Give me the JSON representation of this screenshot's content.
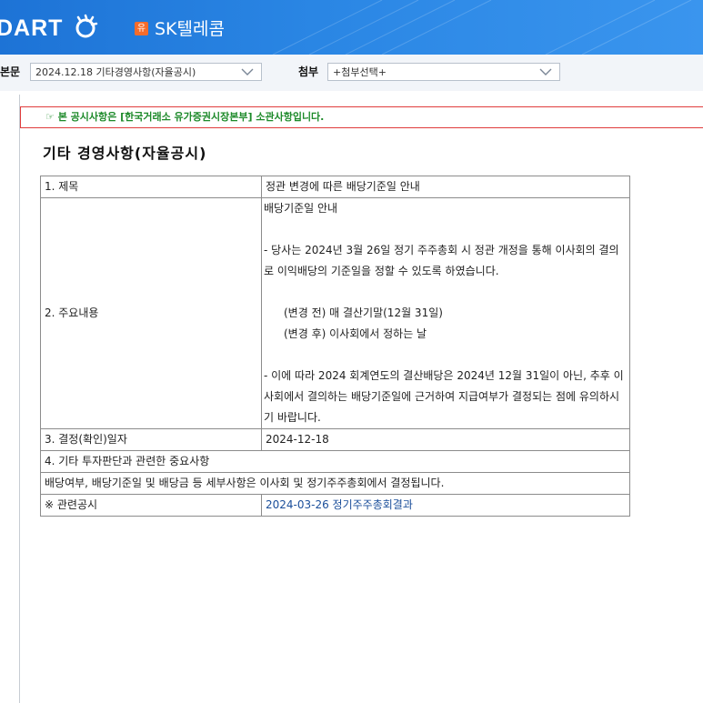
{
  "header": {
    "logo_text": "DART",
    "corp_badge": "유",
    "corp_name": "SK텔레콤"
  },
  "toolbar": {
    "body_label": "본문",
    "body_select": "2024.12.18  기타경영사항(자율공시)",
    "attach_label": "첨부",
    "attach_select": "+첨부선택+"
  },
  "notice": "☞ 본 공시사항은 [한국거래소 유가증권시장본부] 소관사항입니다.",
  "doc_title": "기타 경영사항(자율공시)",
  "rows": {
    "title": {
      "label": "1. 제목",
      "value": "정관 변경에 따른 배당기준일 안내"
    },
    "main": {
      "label": "2. 주요내용",
      "heading": "배당기준일 안내",
      "para1": "- 당사는 2024년 3월 26일 정기 주주총회 시 정관 개정을 통해 이사회의 결의로 이익배당의 기준일을 정할 수 있도록 하였습니다.",
      "before": "(변경 전) 매 결산기말(12월 31일)",
      "after": "(변경 후) 이사회에서 정하는 날",
      "para2": "- 이에 따라 2024 회계연도의 결산배당은 2024년 12월 31일이 아닌, 추후 이사회에서 결의하는 배당기준일에 근거하여 지급여부가 결정되는 점에 유의하시기 바랍니다."
    },
    "date": {
      "label": "3. 결정(확인)일자",
      "value": "2024-12-18"
    },
    "other": {
      "label": "4. 기타 투자판단과 관련한 중요사항",
      "value": "배당여부, 배당기준일 및 배당금 등 세부사항은 이사회 및 정기주주총회에서 결정됩니다."
    },
    "related": {
      "label": "※ 관련공시",
      "value": "2024-03-26 정기주주총회결과"
    }
  },
  "colors": {
    "header_blue": "#1d73d6",
    "notice_border": "#e03c3c",
    "notice_text": "#1d8a2a",
    "corp_badge": "#f56c2b",
    "link": "#1a4e9a"
  }
}
